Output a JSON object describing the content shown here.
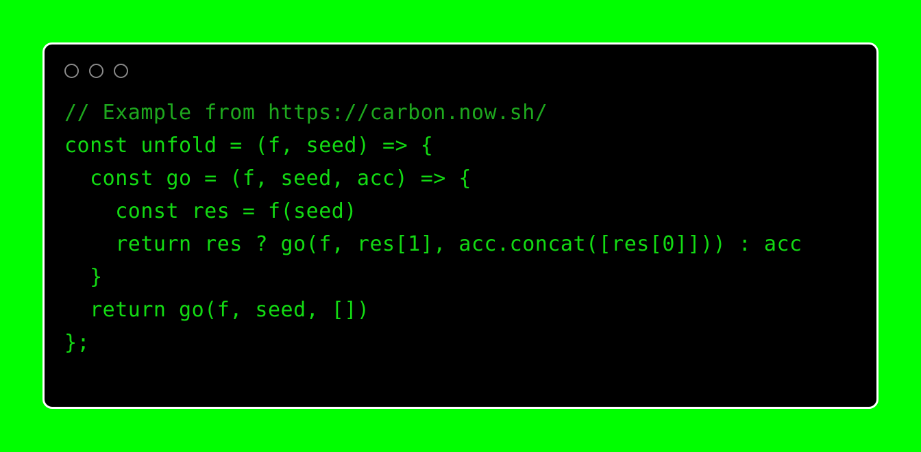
{
  "background": {
    "color": "#00ff00"
  },
  "code_window": {
    "border_color": "#ffffff",
    "background_color": "#000000",
    "titlebar": {
      "dots": [
        {
          "name": "close-dot",
          "color": "#8a8a8a"
        },
        {
          "name": "minimize-dot",
          "color": "#8a8a8a"
        },
        {
          "name": "maximize-dot",
          "color": "#8a8a8a"
        }
      ]
    },
    "code": {
      "language": "javascript",
      "text_color": "#13da13",
      "comment_color": "#1ea81e",
      "lines": [
        {
          "text": "// Example from https://carbon.now.sh/",
          "kind": "comment"
        },
        {
          "text": "const unfold = (f, seed) => {",
          "kind": "code"
        },
        {
          "text": "  const go = (f, seed, acc) => {",
          "kind": "code"
        },
        {
          "text": "    const res = f(seed)",
          "kind": "code"
        },
        {
          "text": "    return res ? go(f, res[1], acc.concat([res[0]])) : acc",
          "kind": "code"
        },
        {
          "text": "  }",
          "kind": "code"
        },
        {
          "text": "  return go(f, seed, [])",
          "kind": "code"
        },
        {
          "text": "};",
          "kind": "code"
        }
      ]
    }
  }
}
